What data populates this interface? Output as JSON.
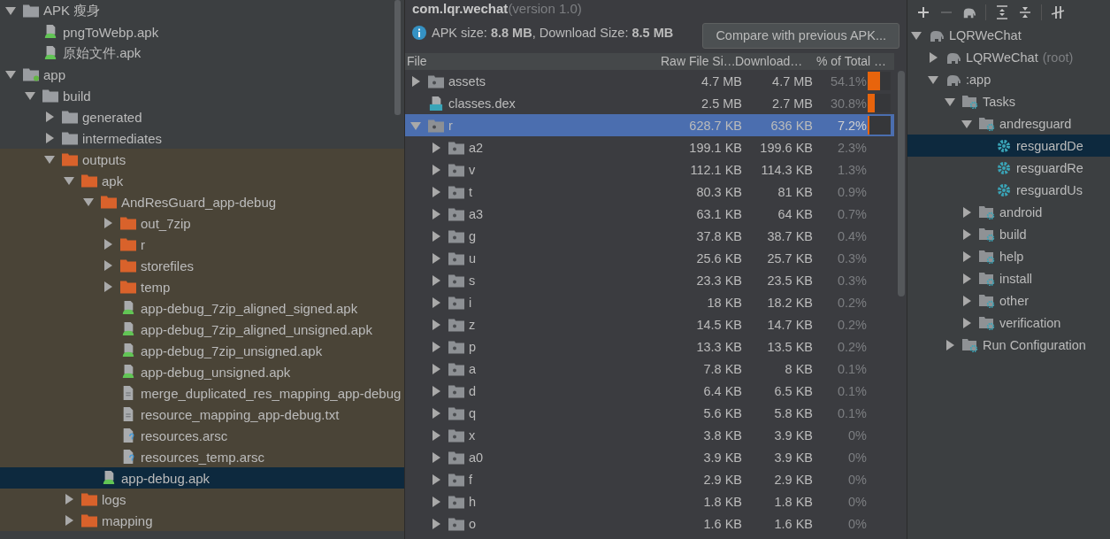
{
  "project_tree": [
    {
      "name": "APK 瘦身",
      "kind": "folder",
      "expanded": true,
      "selected": false,
      "excluded": false,
      "children": [
        {
          "name": "pngToWebp.apk",
          "kind": "apk",
          "selected": false,
          "excluded": false
        },
        {
          "name": "原始文件.apk",
          "kind": "apk",
          "selected": false,
          "excluded": false
        }
      ]
    },
    {
      "name": "app",
      "kind": "module",
      "expanded": true,
      "selected": false,
      "excluded": false,
      "children": [
        {
          "name": "build",
          "kind": "folder",
          "expanded": true,
          "selected": false,
          "excluded": false,
          "children": [
            {
              "name": "generated",
              "kind": "folder",
              "expanded": false,
              "selected": false,
              "excluded": false
            },
            {
              "name": "intermediates",
              "kind": "folder",
              "expanded": false,
              "selected": false,
              "excluded": false
            },
            {
              "name": "outputs",
              "kind": "orange_folder",
              "expanded": true,
              "selected": false,
              "excluded": true,
              "children": [
                {
                  "name": "apk",
                  "kind": "orange_folder",
                  "expanded": true,
                  "selected": false,
                  "excluded": true,
                  "children": [
                    {
                      "name": "AndResGuard_app-debug",
                      "kind": "orange_folder",
                      "expanded": true,
                      "selected": false,
                      "excluded": true,
                      "children": [
                        {
                          "name": "out_7zip",
                          "kind": "orange_folder",
                          "expanded": false,
                          "selected": false,
                          "excluded": true
                        },
                        {
                          "name": "r",
                          "kind": "orange_folder",
                          "expanded": false,
                          "selected": false,
                          "excluded": true
                        },
                        {
                          "name": "storefiles",
                          "kind": "orange_folder",
                          "expanded": false,
                          "selected": false,
                          "excluded": true
                        },
                        {
                          "name": "temp",
                          "kind": "orange_folder",
                          "expanded": false,
                          "selected": false,
                          "excluded": true
                        },
                        {
                          "name": "app-debug_7zip_aligned_signed.apk",
                          "kind": "apk",
                          "selected": false,
                          "excluded": true
                        },
                        {
                          "name": "app-debug_7zip_aligned_unsigned.apk",
                          "kind": "apk",
                          "selected": false,
                          "excluded": true
                        },
                        {
                          "name": "app-debug_7zip_unsigned.apk",
                          "kind": "apk",
                          "selected": false,
                          "excluded": true
                        },
                        {
                          "name": "app-debug_unsigned.apk",
                          "kind": "apk",
                          "selected": false,
                          "excluded": true
                        },
                        {
                          "name": "merge_duplicated_res_mapping_app-debug",
                          "kind": "text",
                          "selected": false,
                          "excluded": true
                        },
                        {
                          "name": "resource_mapping_app-debug.txt",
                          "kind": "text",
                          "selected": false,
                          "excluded": true
                        },
                        {
                          "name": "resources.arsc",
                          "kind": "unknown",
                          "selected": false,
                          "excluded": true
                        },
                        {
                          "name": "resources_temp.arsc",
                          "kind": "unknown",
                          "selected": false,
                          "excluded": true
                        }
                      ]
                    },
                    {
                      "name": "app-debug.apk",
                      "kind": "apk",
                      "selected": true,
                      "excluded": true
                    }
                  ]
                },
                {
                  "name": "logs",
                  "kind": "orange_folder",
                  "expanded": false,
                  "selected": false,
                  "excluded": true
                },
                {
                  "name": "mapping",
                  "kind": "orange_folder",
                  "expanded": false,
                  "selected": false,
                  "excluded": true
                }
              ]
            }
          ]
        }
      ]
    }
  ],
  "apk_analyzer": {
    "package": "com.lqr.wechat",
    "version": "(version 1.0)",
    "summary": "APK size: **8.8 MB**, Download Size: **8.5 MB**",
    "compare_button": "Compare with previous APK...",
    "columns": [
      "File",
      "Raw File Si…",
      "Download…",
      "% of Total …"
    ],
    "rows": [
      {
        "name": "assets",
        "kind": "folder",
        "expanded": false,
        "selected": false,
        "raw": "4.7 MB",
        "download": "4.7 MB",
        "percent": "54.1%",
        "level": 0.541
      },
      {
        "name": "classes.dex",
        "kind": "dex",
        "selected": false,
        "raw": "2.5 MB",
        "download": "2.7 MB",
        "percent": "30.8%",
        "level": 0.308
      },
      {
        "name": "r",
        "kind": "folder",
        "expanded": true,
        "selected": true,
        "raw": "628.7 KB",
        "download": "636 KB",
        "percent": "7.2%",
        "level": 0.072,
        "children": [
          {
            "name": "a2",
            "kind": "folder",
            "expanded": false,
            "selected": false,
            "raw": "199.1 KB",
            "download": "199.6 KB",
            "percent": "2.3%"
          },
          {
            "name": "v",
            "kind": "folder",
            "expanded": false,
            "selected": false,
            "raw": "112.1 KB",
            "download": "114.3 KB",
            "percent": "1.3%"
          },
          {
            "name": "t",
            "kind": "folder",
            "expanded": false,
            "selected": false,
            "raw": "80.3 KB",
            "download": "81 KB",
            "percent": "0.9%"
          },
          {
            "name": "a3",
            "kind": "folder",
            "expanded": false,
            "selected": false,
            "raw": "63.1 KB",
            "download": "64 KB",
            "percent": "0.7%"
          },
          {
            "name": "g",
            "kind": "folder",
            "expanded": false,
            "selected": false,
            "raw": "37.8 KB",
            "download": "38.7 KB",
            "percent": "0.4%"
          },
          {
            "name": "u",
            "kind": "folder",
            "expanded": false,
            "selected": false,
            "raw": "25.6 KB",
            "download": "25.7 KB",
            "percent": "0.3%"
          },
          {
            "name": "s",
            "kind": "folder",
            "expanded": false,
            "selected": false,
            "raw": "23.3 KB",
            "download": "23.5 KB",
            "percent": "0.3%"
          },
          {
            "name": "i",
            "kind": "folder",
            "expanded": false,
            "selected": false,
            "raw": "18 KB",
            "download": "18.2 KB",
            "percent": "0.2%"
          },
          {
            "name": "z",
            "kind": "folder",
            "expanded": false,
            "selected": false,
            "raw": "14.5 KB",
            "download": "14.7 KB",
            "percent": "0.2%"
          },
          {
            "name": "p",
            "kind": "folder",
            "expanded": false,
            "selected": false,
            "raw": "13.3 KB",
            "download": "13.5 KB",
            "percent": "0.2%"
          },
          {
            "name": "a",
            "kind": "folder",
            "expanded": false,
            "selected": false,
            "raw": "7.8 KB",
            "download": "8 KB",
            "percent": "0.1%"
          },
          {
            "name": "d",
            "kind": "folder",
            "expanded": false,
            "selected": false,
            "raw": "6.4 KB",
            "download": "6.5 KB",
            "percent": "0.1%"
          },
          {
            "name": "q",
            "kind": "folder",
            "expanded": false,
            "selected": false,
            "raw": "5.6 KB",
            "download": "5.8 KB",
            "percent": "0.1%"
          },
          {
            "name": "x",
            "kind": "folder",
            "expanded": false,
            "selected": false,
            "raw": "3.8 KB",
            "download": "3.9 KB",
            "percent": "0%"
          },
          {
            "name": "a0",
            "kind": "folder",
            "expanded": false,
            "selected": false,
            "raw": "3.9 KB",
            "download": "3.9 KB",
            "percent": "0%"
          },
          {
            "name": "f",
            "kind": "folder",
            "expanded": false,
            "selected": false,
            "raw": "2.9 KB",
            "download": "2.9 KB",
            "percent": "0%"
          },
          {
            "name": "h",
            "kind": "folder",
            "expanded": false,
            "selected": false,
            "raw": "1.8 KB",
            "download": "1.8 KB",
            "percent": "0%"
          },
          {
            "name": "o",
            "kind": "folder",
            "expanded": false,
            "selected": false,
            "raw": "1.6 KB",
            "download": "1.6 KB",
            "percent": "0%"
          }
        ]
      }
    ]
  },
  "gradle_tree": [
    {
      "name": "LQRWeChat",
      "kind": "project",
      "expanded": true,
      "selected": false,
      "children": [
        {
          "name": "LQRWeChat",
          "suffix": "(root)",
          "kind": "project",
          "expanded": false,
          "selected": false
        },
        {
          "name": ":app",
          "kind": "project",
          "expanded": true,
          "selected": false,
          "children": [
            {
              "name": "Tasks",
              "kind": "group",
              "expanded": true,
              "selected": false,
              "children": [
                {
                  "name": "andresguard",
                  "kind": "group",
                  "expanded": true,
                  "selected": false,
                  "children": [
                    {
                      "name": "resguardDe",
                      "kind": "task",
                      "selected": true
                    },
                    {
                      "name": "resguardRe",
                      "kind": "task",
                      "selected": false
                    },
                    {
                      "name": "resguardUs",
                      "kind": "task",
                      "selected": false
                    }
                  ]
                },
                {
                  "name": "android",
                  "kind": "group",
                  "expanded": false,
                  "selected": false
                },
                {
                  "name": "build",
                  "kind": "group",
                  "expanded": false,
                  "selected": false
                },
                {
                  "name": "help",
                  "kind": "group",
                  "expanded": false,
                  "selected": false
                },
                {
                  "name": "install",
                  "kind": "group",
                  "expanded": false,
                  "selected": false
                },
                {
                  "name": "other",
                  "kind": "group",
                  "expanded": false,
                  "selected": false
                },
                {
                  "name": "verification",
                  "kind": "group",
                  "expanded": false,
                  "selected": false
                }
              ]
            },
            {
              "name": "Run Configuration",
              "kind": "group",
              "expanded": false,
              "selected": false
            }
          ]
        }
      ]
    }
  ]
}
